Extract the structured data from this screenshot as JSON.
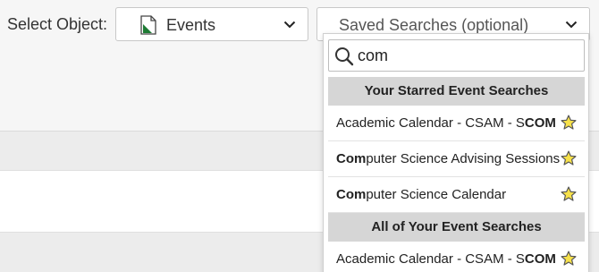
{
  "toolbar": {
    "select_object_label": "Select Object:",
    "object_value": "Events",
    "saved_searches_placeholder": "Saved Searches (optional)"
  },
  "dropdown": {
    "search_value": "com",
    "groups": [
      {
        "header": "Your Starred Event Searches",
        "items": [
          {
            "pre": "Academic Calendar - CSAM - S",
            "bold": "COM",
            "post": ""
          },
          {
            "pre": "",
            "bold": "Com",
            "post": "puter Science Advising Sessions"
          },
          {
            "pre": "",
            "bold": "Com",
            "post": "puter Science Calendar"
          }
        ]
      },
      {
        "header": "All of Your Event Searches",
        "items": [
          {
            "pre": "Academic Calendar - CSAM - S",
            "bold": "COM",
            "post": ""
          }
        ]
      }
    ]
  },
  "icons": {
    "object_icon": "document-icon",
    "search": "search-icon",
    "star": "star-icon",
    "chevron": "chevron-down-icon"
  },
  "colors": {
    "doc_icon_green": "#1e7b34",
    "star_fill": "#f7e14a",
    "group_header_bg": "#d6d6d6"
  }
}
